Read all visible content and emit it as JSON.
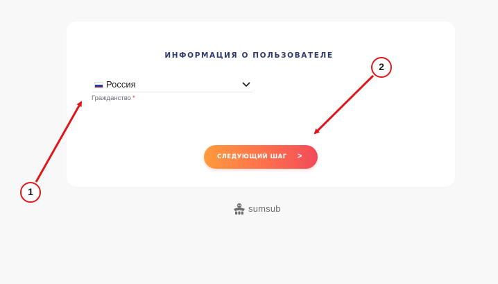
{
  "form": {
    "title": "ИНФОРМАЦИЯ О ПОЛЬЗОВАТЕЛЕ",
    "citizenship": {
      "selected_value": "Россия",
      "label": "Гражданство",
      "required_mark": "*",
      "flag_colors": [
        "#ffffff",
        "#1c3fa8",
        "#d52b1e"
      ]
    },
    "next_button": {
      "label": "СЛЕДУЮЩИЙ ШАГ",
      "arrow": ">"
    }
  },
  "footer": {
    "brand": "sumsub",
    "icon": "sumsub-logo-icon"
  },
  "annotations": {
    "marker_1": "1",
    "marker_2": "2",
    "color": "#e0161b"
  },
  "colors": {
    "background": "#f8f8f8",
    "card": "#ffffff",
    "title": "#2e3a6e",
    "button_gradient": [
      "#ff9b3d",
      "#ff6f4c",
      "#f24b5a"
    ],
    "required": "#e53935"
  }
}
